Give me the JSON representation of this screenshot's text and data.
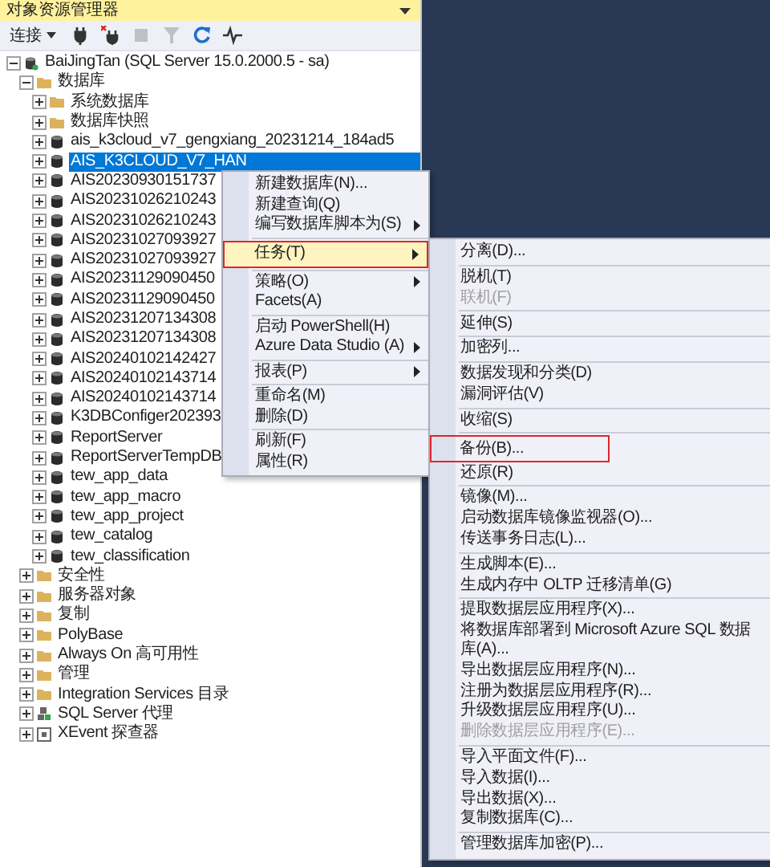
{
  "panel": {
    "title": "对象资源管理器"
  },
  "toolbar": {
    "connect_label": "连接",
    "buttons": [
      {
        "kind": "plug",
        "disabled": false
      },
      {
        "kind": "disconnect",
        "disabled": false
      },
      {
        "kind": "stop",
        "disabled": true
      },
      {
        "kind": "filter",
        "disabled": true
      },
      {
        "kind": "refresh",
        "disabled": false
      },
      {
        "kind": "activity",
        "disabled": false
      }
    ]
  },
  "tree": {
    "nodes": [
      {
        "label": "BaiJingTan (SQL Server 15.0.2000.5 - sa)",
        "kind": "server",
        "expanded": true,
        "selected": false,
        "children": [
          {
            "label": "数据库",
            "kind": "folder",
            "expanded": true,
            "selected": false,
            "children": [
              {
                "label": "系统数据库",
                "kind": "folder",
                "expanded": false,
                "selected": false
              },
              {
                "label": "数据库快照",
                "kind": "folder",
                "expanded": false,
                "selected": false
              },
              {
                "label": "ais_k3cloud_v7_gengxiang_20231214_184ad5",
                "kind": "database",
                "expanded": false,
                "selected": false
              },
              {
                "label": "AIS_K3CLOUD_V7_HAN",
                "kind": "database",
                "expanded": false,
                "selected": true
              },
              {
                "label": "AIS20230930151737",
                "kind": "database",
                "expanded": false,
                "selected": false
              },
              {
                "label": "AIS20231026210243",
                "kind": "database",
                "expanded": false,
                "selected": false
              },
              {
                "label": "AIS20231026210243",
                "kind": "database",
                "expanded": false,
                "selected": false
              },
              {
                "label": "AIS20231027093927",
                "kind": "database",
                "expanded": false,
                "selected": false
              },
              {
                "label": "AIS20231027093927",
                "kind": "database",
                "expanded": false,
                "selected": false
              },
              {
                "label": "AIS20231129090450",
                "kind": "database",
                "expanded": false,
                "selected": false
              },
              {
                "label": "AIS20231129090450",
                "kind": "database",
                "expanded": false,
                "selected": false
              },
              {
                "label": "AIS20231207134308",
                "kind": "database",
                "expanded": false,
                "selected": false
              },
              {
                "label": "AIS20231207134308",
                "kind": "database",
                "expanded": false,
                "selected": false
              },
              {
                "label": "AIS20240102142427",
                "kind": "database",
                "expanded": false,
                "selected": false
              },
              {
                "label": "AIS20240102143714",
                "kind": "database",
                "expanded": false,
                "selected": false
              },
              {
                "label": "AIS20240102143714",
                "kind": "database",
                "expanded": false,
                "selected": false
              },
              {
                "label": "K3DBConfiger202393",
                "kind": "database",
                "expanded": false,
                "selected": false
              },
              {
                "label": "ReportServer",
                "kind": "database",
                "expanded": false,
                "selected": false
              },
              {
                "label": "ReportServerTempDB",
                "kind": "database",
                "expanded": false,
                "selected": false
              },
              {
                "label": "tew_app_data",
                "kind": "database",
                "expanded": false,
                "selected": false
              },
              {
                "label": "tew_app_macro",
                "kind": "database",
                "expanded": false,
                "selected": false
              },
              {
                "label": "tew_app_project",
                "kind": "database",
                "expanded": false,
                "selected": false
              },
              {
                "label": "tew_catalog",
                "kind": "database",
                "expanded": false,
                "selected": false
              },
              {
                "label": "tew_classification",
                "kind": "database",
                "expanded": false,
                "selected": false
              }
            ]
          },
          {
            "label": "安全性",
            "kind": "folder",
            "expanded": false,
            "selected": false
          },
          {
            "label": "服务器对象",
            "kind": "folder",
            "expanded": false,
            "selected": false
          },
          {
            "label": "复制",
            "kind": "folder",
            "expanded": false,
            "selected": false
          },
          {
            "label": "PolyBase",
            "kind": "folder",
            "expanded": false,
            "selected": false
          },
          {
            "label": "Always On 高可用性",
            "kind": "folder",
            "expanded": false,
            "selected": false
          },
          {
            "label": "管理",
            "kind": "folder",
            "expanded": false,
            "selected": false
          },
          {
            "label": "Integration Services 目录",
            "kind": "folder",
            "expanded": false,
            "selected": false
          },
          {
            "label": "SQL Server 代理",
            "kind": "agent",
            "expanded": false,
            "selected": false
          },
          {
            "label": "XEvent 探查器",
            "kind": "xevent",
            "expanded": false,
            "selected": false
          }
        ]
      }
    ]
  },
  "context_menu": {
    "items": [
      {
        "kind": "item",
        "label": "新建数据库(N)...",
        "submenu": false,
        "highlighted": false,
        "boxed": false
      },
      {
        "kind": "item",
        "label": "新建查询(Q)",
        "submenu": false,
        "highlighted": false,
        "boxed": false
      },
      {
        "kind": "item",
        "label": "编写数据库脚本为(S)",
        "submenu": true,
        "highlighted": false,
        "boxed": false
      },
      {
        "kind": "separator"
      },
      {
        "kind": "item",
        "label": "任务(T)",
        "submenu": true,
        "highlighted": true,
        "boxed": true
      },
      {
        "kind": "separator"
      },
      {
        "kind": "item",
        "label": "策略(O)",
        "submenu": true,
        "highlighted": false,
        "boxed": false
      },
      {
        "kind": "item",
        "label": "Facets(A)",
        "submenu": false,
        "highlighted": false,
        "boxed": false
      },
      {
        "kind": "separator"
      },
      {
        "kind": "item",
        "label": "启动 PowerShell(H)",
        "submenu": false,
        "highlighted": false,
        "boxed": false
      },
      {
        "kind": "item",
        "label": "Azure Data Studio (A)",
        "submenu": true,
        "highlighted": false,
        "boxed": false
      },
      {
        "kind": "separator"
      },
      {
        "kind": "item",
        "label": "报表(P)",
        "submenu": true,
        "highlighted": false,
        "boxed": false
      },
      {
        "kind": "separator"
      },
      {
        "kind": "item",
        "label": "重命名(M)",
        "submenu": false,
        "highlighted": false,
        "boxed": false
      },
      {
        "kind": "item",
        "label": "删除(D)",
        "submenu": false,
        "highlighted": false,
        "boxed": false
      },
      {
        "kind": "separator"
      },
      {
        "kind": "item",
        "label": "刷新(F)",
        "submenu": false,
        "highlighted": false,
        "boxed": false
      },
      {
        "kind": "item",
        "label": "属性(R)",
        "submenu": false,
        "highlighted": false,
        "boxed": false
      }
    ]
  },
  "tasks_submenu": {
    "items": [
      {
        "kind": "item",
        "label": "分离(D)...",
        "disabled": false,
        "boxed": false
      },
      {
        "kind": "separator"
      },
      {
        "kind": "item",
        "label": "脱机(T)",
        "disabled": false,
        "boxed": false
      },
      {
        "kind": "item",
        "label": "联机(F)",
        "disabled": true,
        "boxed": false
      },
      {
        "kind": "separator"
      },
      {
        "kind": "item",
        "label": "延伸(S)",
        "disabled": false,
        "boxed": false
      },
      {
        "kind": "separator"
      },
      {
        "kind": "item",
        "label": "加密列...",
        "disabled": false,
        "boxed": false
      },
      {
        "kind": "separator"
      },
      {
        "kind": "item",
        "label": "数据发现和分类(D)",
        "disabled": false,
        "boxed": false
      },
      {
        "kind": "item",
        "label": "漏洞评估(V)",
        "disabled": false,
        "boxed": false
      },
      {
        "kind": "separator"
      },
      {
        "kind": "item",
        "label": "收缩(S)",
        "disabled": false,
        "boxed": false
      },
      {
        "kind": "separator"
      },
      {
        "kind": "item",
        "label": "备份(B)...",
        "disabled": false,
        "boxed": true
      },
      {
        "kind": "item",
        "label": "还原(R)",
        "disabled": false,
        "boxed": false
      },
      {
        "kind": "separator"
      },
      {
        "kind": "item",
        "label": "镜像(M)...",
        "disabled": false,
        "boxed": false
      },
      {
        "kind": "item",
        "label": "启动数据库镜像监视器(O)...",
        "disabled": false,
        "boxed": false
      },
      {
        "kind": "item",
        "label": "传送事务日志(L)...",
        "disabled": false,
        "boxed": false
      },
      {
        "kind": "separator"
      },
      {
        "kind": "item",
        "label": "生成脚本(E)...",
        "disabled": false,
        "boxed": false
      },
      {
        "kind": "item",
        "label": "生成内存中 OLTP 迁移清单(G)",
        "disabled": false,
        "boxed": false
      },
      {
        "kind": "separator"
      },
      {
        "kind": "item",
        "label": "提取数据层应用程序(X)...",
        "disabled": false,
        "boxed": false
      },
      {
        "kind": "item",
        "label": "将数据库部署到 Microsoft Azure SQL 数据库(A)...",
        "disabled": false,
        "boxed": false
      },
      {
        "kind": "item",
        "label": "导出数据层应用程序(N)...",
        "disabled": false,
        "boxed": false
      },
      {
        "kind": "item",
        "label": "注册为数据层应用程序(R)...",
        "disabled": false,
        "boxed": false
      },
      {
        "kind": "item",
        "label": "升级数据层应用程序(U)...",
        "disabled": false,
        "boxed": false
      },
      {
        "kind": "item",
        "label": "删除数据层应用程序(E)...",
        "disabled": true,
        "boxed": false
      },
      {
        "kind": "separator"
      },
      {
        "kind": "item",
        "label": "导入平面文件(F)...",
        "disabled": false,
        "boxed": false
      },
      {
        "kind": "item",
        "label": "导入数据(I)...",
        "disabled": false,
        "boxed": false
      },
      {
        "kind": "item",
        "label": "导出数据(X)...",
        "disabled": false,
        "boxed": false
      },
      {
        "kind": "item",
        "label": "复制数据库(C)...",
        "disabled": false,
        "boxed": false
      },
      {
        "kind": "separator"
      },
      {
        "kind": "item",
        "label": "管理数据库加密(P)...",
        "disabled": false,
        "boxed": false
      }
    ]
  }
}
